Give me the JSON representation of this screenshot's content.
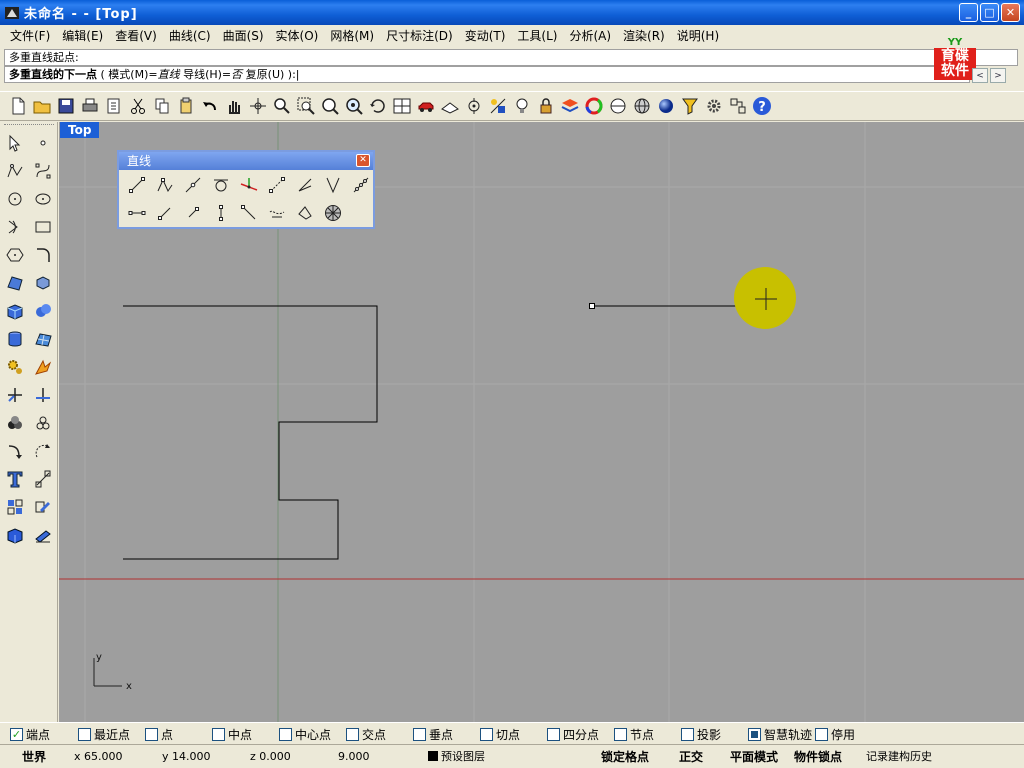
{
  "window": {
    "title": "未命名 -  - [Top]",
    "minimize": "_",
    "maximize": "□",
    "close": "✕"
  },
  "menu": [
    "文件(F)",
    "编辑(E)",
    "查看(V)",
    "曲线(C)",
    "曲面(S)",
    "实体(O)",
    "网格(M)",
    "尺寸标注(D)",
    "变动(T)",
    "工具(L)",
    "分析(A)",
    "渲染(R)",
    "说明(H)"
  ],
  "command": {
    "history": "多重直线起点:",
    "prompt": "多重直线的下一点",
    "options_prefix": " ( 模式(M)=",
    "mode_value": "直线",
    "guide_label": "  导线(H)=",
    "guide_value": "否",
    "undo_label": "  复原(U) ):",
    "cursor": "|"
  },
  "logo": {
    "top": "YY",
    "line1": "育碟",
    "line2": "软件"
  },
  "scroll": {
    "left": "<",
    "right": ">"
  },
  "viewport": {
    "label": "Top",
    "axis_y": "y",
    "axis_x": "x"
  },
  "palette": {
    "title": "直线",
    "close": "✕"
  },
  "osnaps": [
    {
      "label": "端点",
      "checked": true
    },
    {
      "label": "最近点",
      "checked": false
    },
    {
      "label": "点",
      "checked": false
    },
    {
      "label": "中点",
      "checked": false
    },
    {
      "label": "中心点",
      "checked": false
    },
    {
      "label": "交点",
      "checked": false
    },
    {
      "label": "垂点",
      "checked": false
    },
    {
      "label": "切点",
      "checked": false
    },
    {
      "label": "四分点",
      "checked": false
    },
    {
      "label": "节点",
      "checked": false
    },
    {
      "label": "投影",
      "checked": false
    },
    {
      "label": "智慧轨迹",
      "checked": true
    },
    {
      "label": "停用",
      "checked": false
    }
  ],
  "status": {
    "cplane": "世界",
    "x": "x 65.000",
    "y": "y 14.000",
    "z": "z 0.000",
    "dist": "9.000",
    "layer": "预设图层",
    "snap": "锁定格点",
    "ortho": "正交",
    "planar": "平面模式",
    "osnap": "物件锁点",
    "history": "记录建构历史"
  },
  "colors": {
    "titlebar": "#0a5fd8",
    "viewport_bg": "#9e9e9e",
    "x_axis": "#b03030",
    "cursor_highlight": "#c8c000"
  }
}
